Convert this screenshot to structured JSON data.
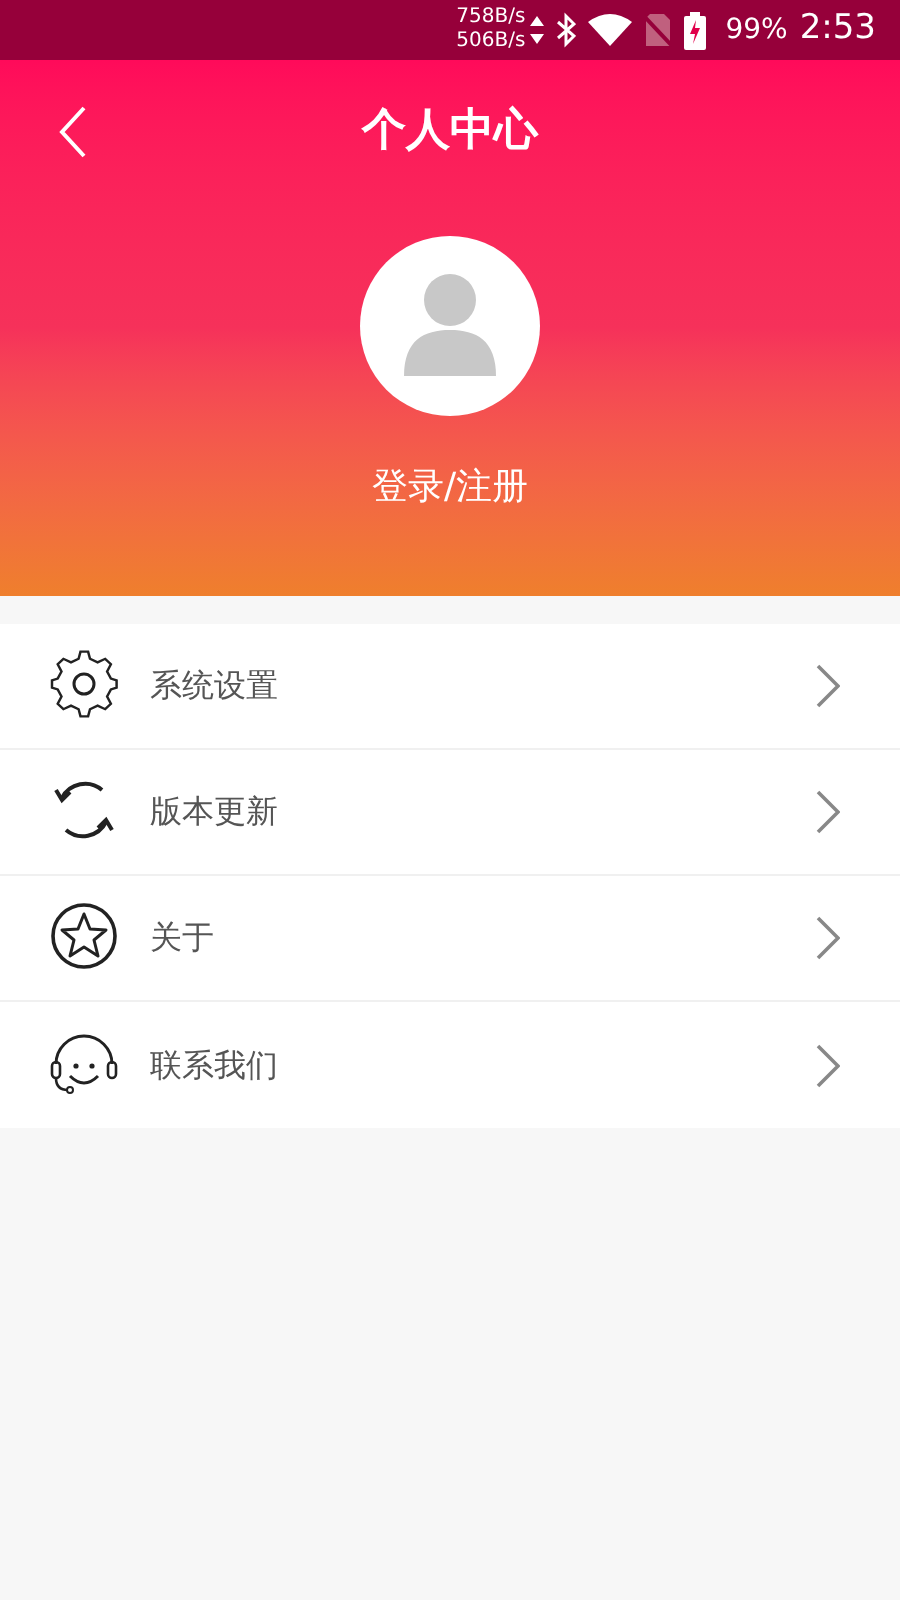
{
  "status_bar": {
    "upload_speed": "758B/s",
    "download_speed": "506B/s",
    "battery": "99%",
    "time": "2:53"
  },
  "header": {
    "title": "个人中心"
  },
  "profile": {
    "login_label": "登录/注册"
  },
  "menu": [
    {
      "kind": "gear",
      "label": "系统设置"
    },
    {
      "kind": "refresh",
      "label": "版本更新"
    },
    {
      "kind": "star",
      "label": "关于"
    },
    {
      "kind": "headset",
      "label": "联系我们"
    }
  ]
}
